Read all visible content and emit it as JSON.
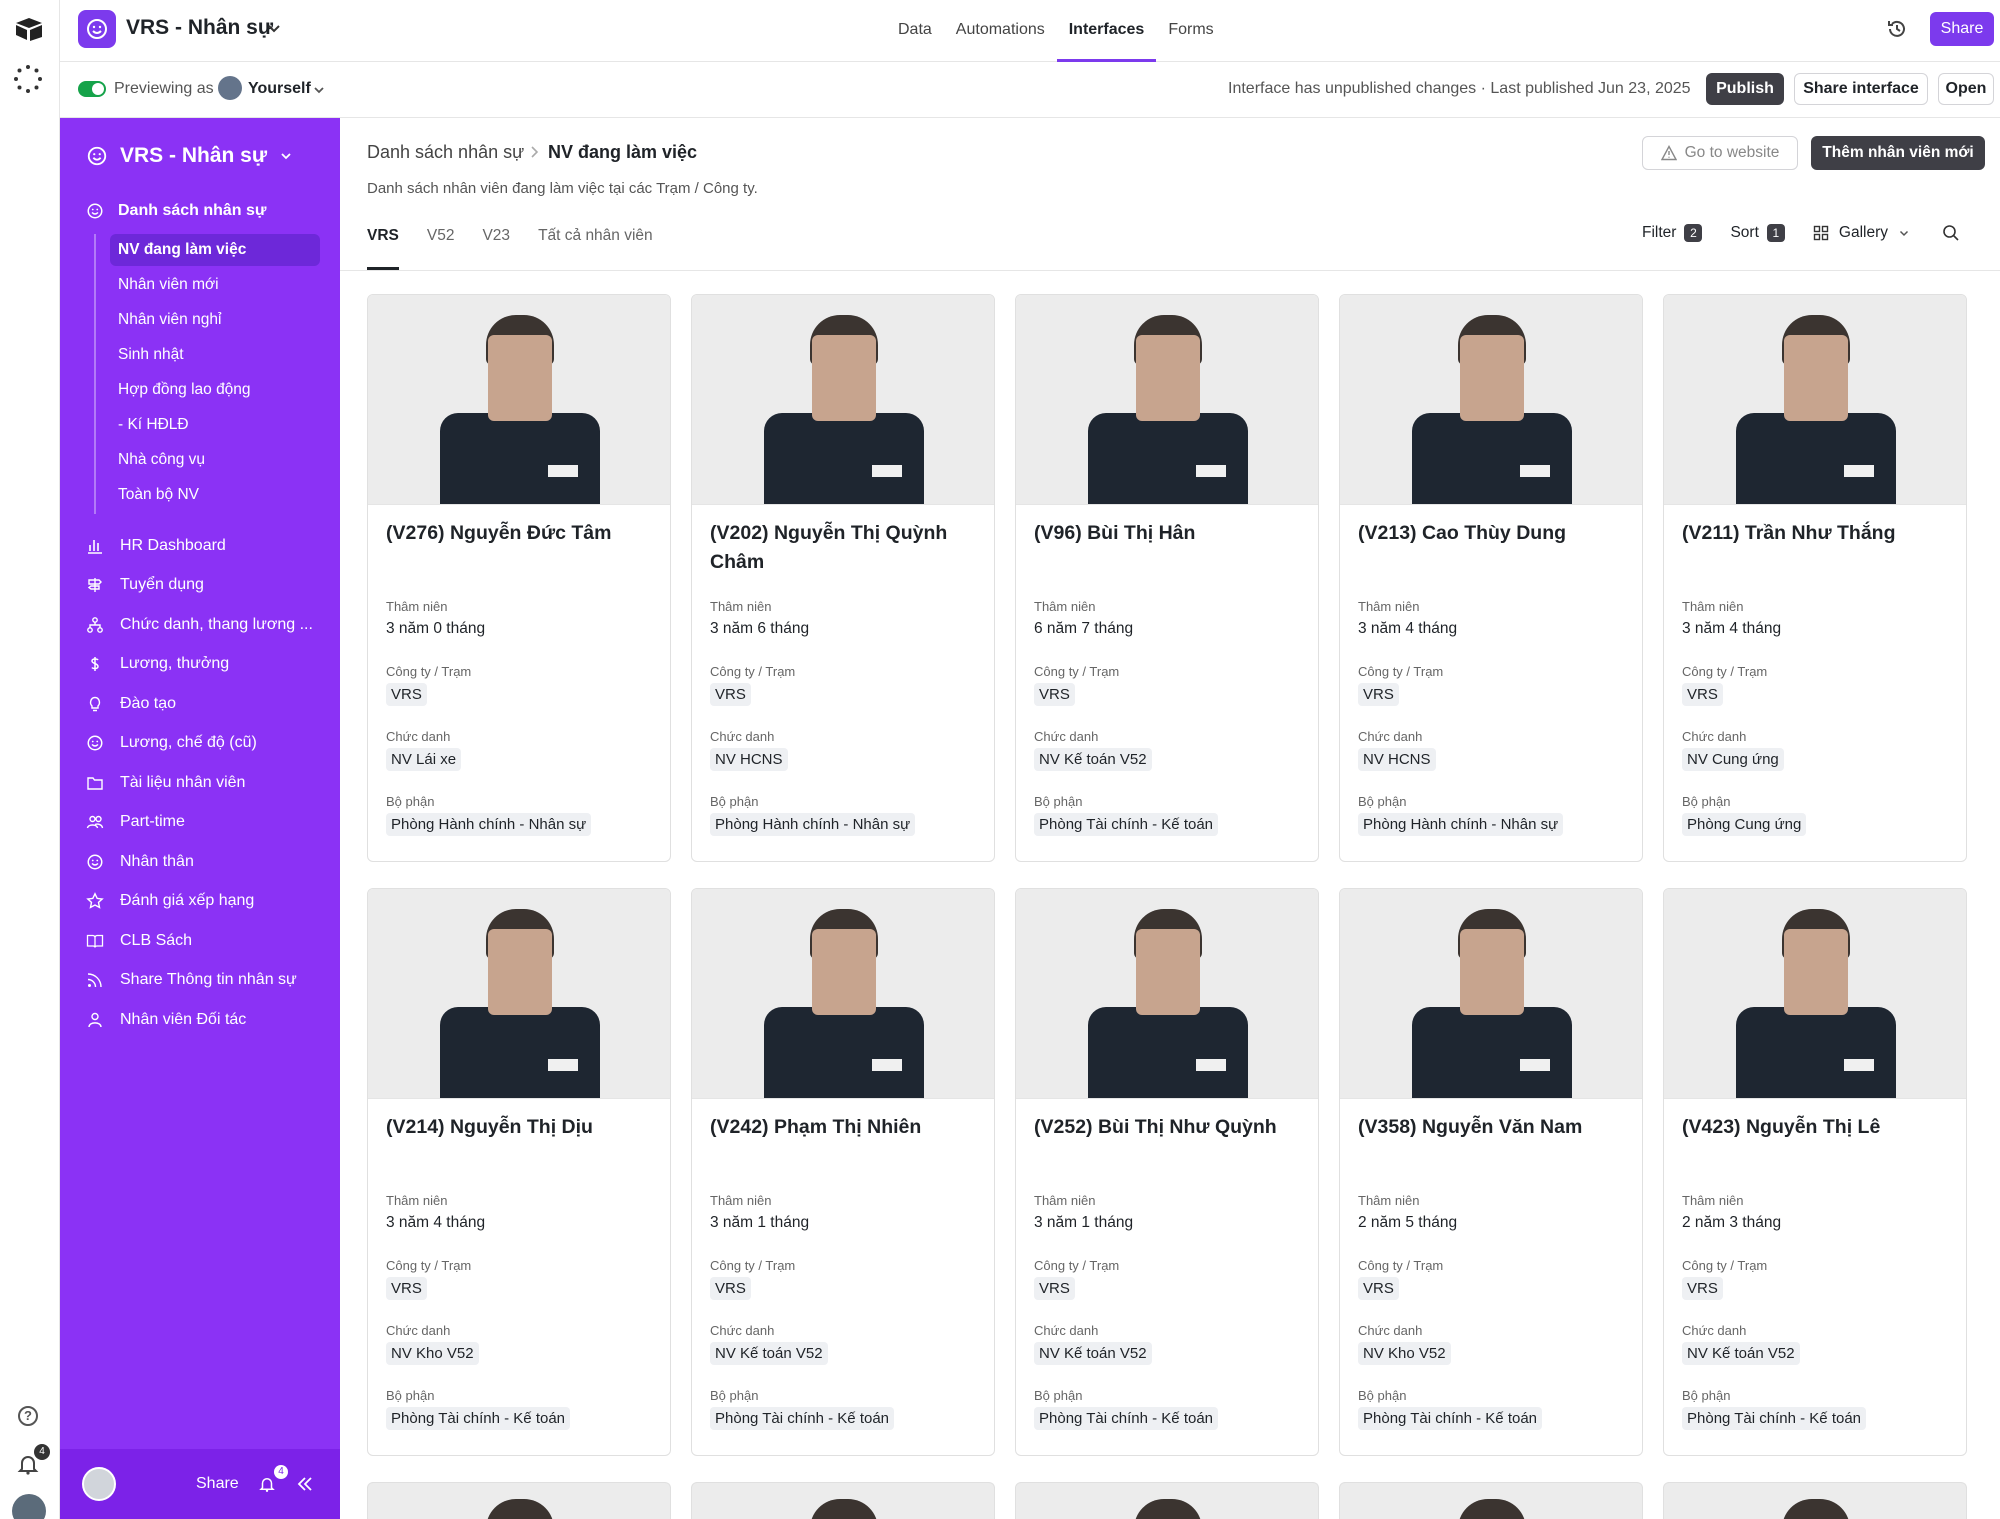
{
  "topbar": {
    "app_title": "VRS - Nhân sự",
    "tabs": [
      {
        "label": "Data",
        "active": false
      },
      {
        "label": "Automations",
        "active": false
      },
      {
        "label": "Interfaces",
        "active": true
      },
      {
        "label": "Forms",
        "active": false
      }
    ],
    "share_label": "Share"
  },
  "previewbar": {
    "label": "Previewing as",
    "user": "Yourself",
    "status": "Interface has unpublished changes · Last published Jun 23, 2025",
    "publish_label": "Publish",
    "share_interface_label": "Share interface",
    "open_label": "Open"
  },
  "rail": {
    "bell_count": "4"
  },
  "sidebar": {
    "title": "VRS - Nhân sự",
    "section": "Danh sách nhân sự",
    "sub_items": [
      {
        "label": "NV đang làm việc",
        "active": true
      },
      {
        "label": "Nhân viên mới",
        "active": false
      },
      {
        "label": "Nhân viên nghỉ",
        "active": false
      },
      {
        "label": "Sinh nhật",
        "active": false
      },
      {
        "label": "Hợp đồng lao động",
        "active": false
      },
      {
        "label": "- Kí HĐLĐ",
        "active": false
      },
      {
        "label": "Nhà công vụ",
        "active": false
      },
      {
        "label": "Toàn bộ NV",
        "active": false
      }
    ],
    "nav_items": [
      {
        "label": "HR Dashboard",
        "icon": "bar-chart-icon"
      },
      {
        "label": "Tuyển dụng",
        "icon": "signpost-icon"
      },
      {
        "label": "Chức danh, thang lương ...",
        "icon": "org-chart-icon"
      },
      {
        "label": "Lương, thưởng",
        "icon": "dollar-icon"
      },
      {
        "label": "Đào tạo",
        "icon": "lightbulb-icon"
      },
      {
        "label": "Lương, chế độ (cũ)",
        "icon": "smiley-icon"
      },
      {
        "label": "Tài liệu nhân viên",
        "icon": "folder-icon"
      },
      {
        "label": "Part-time",
        "icon": "users-icon"
      },
      {
        "label": "Nhân thân",
        "icon": "smiley-icon"
      },
      {
        "label": "Đánh giá xếp hạng",
        "icon": "star-icon"
      },
      {
        "label": "CLB Sách",
        "icon": "book-icon"
      },
      {
        "label": "Share Thông tin nhân sự",
        "icon": "rss-icon"
      },
      {
        "label": "Nhân viên Đối tác",
        "icon": "user-icon"
      }
    ],
    "footer": {
      "share_label": "Share",
      "bell_count": "4"
    }
  },
  "main": {
    "breadcrumb_parent": "Danh sách nhân sự",
    "breadcrumb_current": "NV đang làm việc",
    "description": "Danh sách nhân viên đang làm việc tại các Trạm / Công ty.",
    "go_website_label": "Go to website",
    "add_employee_label": "Thêm nhân viên mới",
    "view_tabs": [
      {
        "label": "VRS",
        "active": true
      },
      {
        "label": "V52",
        "active": false
      },
      {
        "label": "V23",
        "active": false
      },
      {
        "label": "Tất cả nhân viên",
        "active": false
      }
    ],
    "filter_label": "Filter",
    "filter_count": "2",
    "sort_label": "Sort",
    "sort_count": "1",
    "view_label": "Gallery",
    "field_labels": {
      "seniority": "Thâm niên",
      "company": "Công ty / Trạm",
      "title": "Chức danh",
      "department": "Bộ phận"
    }
  },
  "cards": [
    {
      "name": "(V276) Nguyễn Đức Tâm",
      "seniority": "3 năm 0 tháng",
      "company": "VRS",
      "title": "NV Lái xe",
      "department": "Phòng Hành chính - Nhân sự"
    },
    {
      "name": "(V202) Nguyễn Thị Quỳnh Châm",
      "seniority": "3 năm 6 tháng",
      "company": "VRS",
      "title": "NV HCNS",
      "department": "Phòng Hành chính - Nhân sự"
    },
    {
      "name": "(V96) Bùi Thị Hân",
      "seniority": "6 năm 7 tháng",
      "company": "VRS",
      "title": "NV Kế toán V52",
      "department": "Phòng Tài chính - Kế toán"
    },
    {
      "name": "(V213) Cao Thùy Dung",
      "seniority": "3 năm 4 tháng",
      "company": "VRS",
      "title": "NV HCNS",
      "department": "Phòng Hành chính - Nhân sự"
    },
    {
      "name": "(V211) Trần Như Thắng",
      "seniority": "3 năm 4 tháng",
      "company": "VRS",
      "title": "NV Cung ứng",
      "department": "Phòng Cung ứng"
    },
    {
      "name": "(V214) Nguyễn Thị Dịu",
      "seniority": "3 năm 4 tháng",
      "company": "VRS",
      "title": "NV Kho V52",
      "department": "Phòng Tài chính - Kế toán"
    },
    {
      "name": "(V242) Phạm Thị Nhiên",
      "seniority": "3 năm 1 tháng",
      "company": "VRS",
      "title": "NV Kế toán V52",
      "department": "Phòng Tài chính - Kế toán"
    },
    {
      "name": "(V252) Bùi Thị Như Quỳnh",
      "seniority": "3 năm 1 tháng",
      "company": "VRS",
      "title": "NV Kế toán V52",
      "department": "Phòng Tài chính - Kế toán"
    },
    {
      "name": "(V358) Nguyễn Văn Nam",
      "seniority": "2 năm 5 tháng",
      "company": "VRS",
      "title": "NV Kho V52",
      "department": "Phòng Tài chính - Kế toán"
    },
    {
      "name": "(V423) Nguyễn Thị Lê",
      "seniority": "2 năm 3 tháng",
      "company": "VRS",
      "title": "NV Kế toán V52",
      "department": "Phòng Tài chính - Kế toán"
    }
  ],
  "colors": {
    "accent": "#7c3aed",
    "sidebar": "#8b32f5",
    "dark_button": "#3f3f46",
    "toggle_on": "#16a34a"
  }
}
